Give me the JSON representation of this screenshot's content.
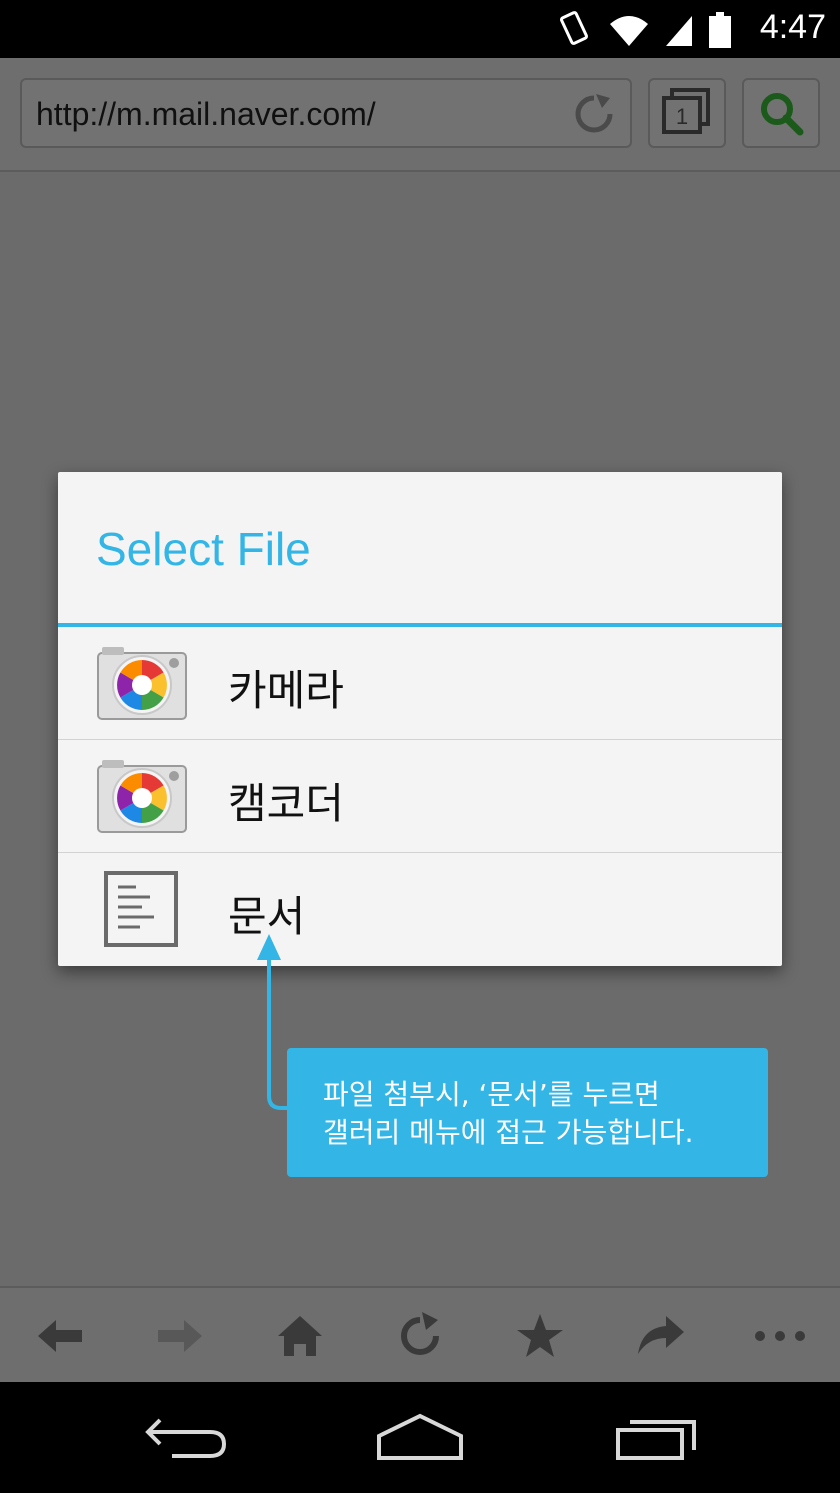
{
  "status_bar": {
    "time": "4:47"
  },
  "browser": {
    "url": "http://m.mail.naver.com/",
    "tab_count": "1"
  },
  "dialog": {
    "title": "Select File",
    "options": [
      {
        "label": "카메라",
        "icon": "camera-icon"
      },
      {
        "label": "캠코더",
        "icon": "camcorder-icon"
      },
      {
        "label": "문서",
        "icon": "document-icon"
      }
    ]
  },
  "callout": {
    "line1": "파일 첨부시, ‘문서’를 누르면",
    "line2": "갤러리 메뉴에 접근 가능합니다."
  },
  "colors": {
    "accent": "#33b5e5",
    "dim_overlay": "#6b6b6b"
  },
  "bottom_bar_icons": [
    "back-arrow-icon",
    "forward-arrow-icon",
    "home-icon",
    "refresh-icon",
    "star-icon",
    "share-icon",
    "more-icon"
  ],
  "nav_bar_icons": [
    "nav-back-icon",
    "nav-home-icon",
    "nav-recents-icon"
  ]
}
